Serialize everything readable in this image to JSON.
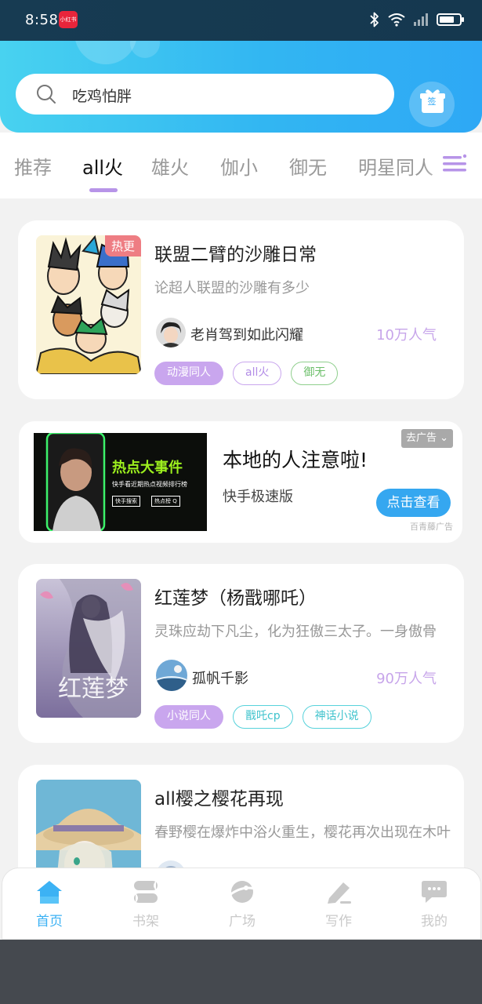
{
  "status_bar": {
    "time": "8:58",
    "app_badge": "小红书",
    "icons": [
      "bluetooth-icon",
      "wifi-icon",
      "signal-icon",
      "battery-icon"
    ],
    "battery_level": 0.75
  },
  "header": {
    "search_placeholder": "吃鸡怕胖",
    "sign_in_label": "签",
    "colors": {
      "gradient_start": "#48d2f0",
      "gradient_end": "#2ea8f5"
    }
  },
  "tabs": {
    "items": [
      "推荐",
      "all火",
      "雄火",
      "伽小",
      "御无",
      "明星同人"
    ],
    "active_index": 1,
    "accent": "#b794e8"
  },
  "feed": [
    {
      "title": "联盟二臂的沙雕日常",
      "description": "论超人联盟的沙雕有多少",
      "author": "老肖驾到如此闪耀",
      "popularity": "10万人气",
      "badge": "热更",
      "tags": [
        {
          "label": "动漫同人",
          "style": "fill-purple"
        },
        {
          "label": "all火",
          "style": "outline-purple"
        },
        {
          "label": "御无",
          "style": "outline-green"
        }
      ]
    },
    {
      "ad": true,
      "title": "本地的人注意啦!",
      "subtitle": "快手极速版",
      "close_label": "去广告",
      "cta_label": "点击查看",
      "source_label": "百青藤广告",
      "image_headline": "热点大事件",
      "image_subline": "快手看近期热点视频排行榜",
      "image_tags": [
        "快手搜索",
        "热点榜 Q"
      ]
    },
    {
      "title": "红莲梦（杨戬哪吒）",
      "description": "灵珠应劫下凡尘，化为狂傲三太子。一身傲骨",
      "author": "孤帆千影",
      "popularity": "90万人气",
      "tags": [
        {
          "label": "小说同人",
          "style": "fill-purple"
        },
        {
          "label": "戬吒cp",
          "style": "outline-cyan"
        },
        {
          "label": "神话小说",
          "style": "outline-cyan"
        }
      ]
    },
    {
      "title": "all樱之樱花再现",
      "description": "春野樱在爆炸中浴火重生，樱花再次出现在木叶"
    }
  ],
  "bottom_nav": {
    "items": [
      {
        "label": "首页",
        "icon": "home-icon"
      },
      {
        "label": "书架",
        "icon": "bookshelf-icon"
      },
      {
        "label": "广场",
        "icon": "planet-icon"
      },
      {
        "label": "写作",
        "icon": "pen-icon"
      },
      {
        "label": "我的",
        "icon": "chat-bubble-icon"
      }
    ],
    "active_index": 0,
    "active_color": "#3cb2f4"
  }
}
